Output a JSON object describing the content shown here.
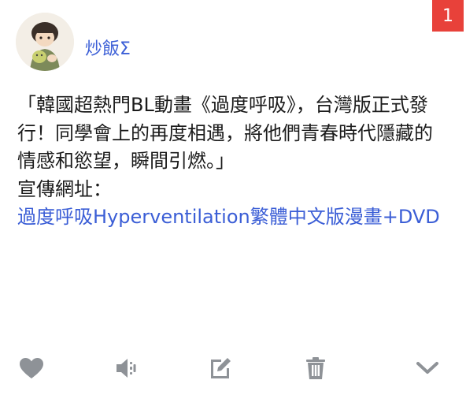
{
  "post": {
    "author": "炒飯Σ",
    "badge_count": "1",
    "paragraph": "「韓國超熱門BL動畫《過度呼吸》，台灣版正式發行！同學會上的再度相遇，將他們青春時代隱藏的情感和慾望，瞬間引燃。」",
    "url_label": "宣傳網址：",
    "link_text": "過度呼吸Hyperventilation繁體中文版漫畫+DVD"
  },
  "toolbar": {
    "icons": [
      "heart-icon",
      "speaker-icon",
      "edit-icon",
      "trash-icon",
      "chevron-down-icon"
    ]
  },
  "colors": {
    "accent": "#3b5ed6",
    "badge": "#e8413a",
    "icon": "#8e9297"
  }
}
